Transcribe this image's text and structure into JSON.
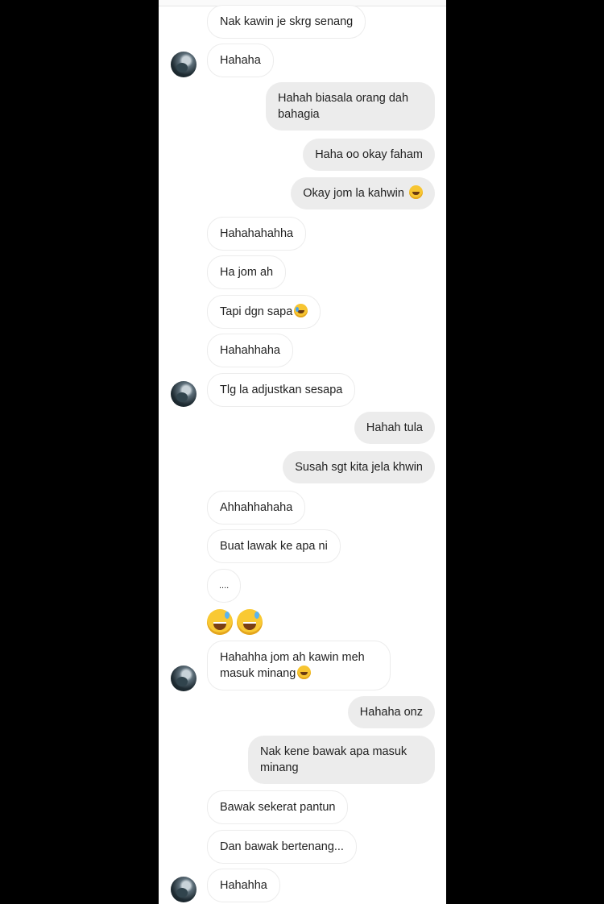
{
  "messages": [
    {
      "side": "in",
      "text": "Nak kawin je skrg senang"
    },
    {
      "side": "in",
      "text": "Hahaha"
    },
    {
      "side": "out",
      "text": "Hahah biasala orang dah bahagia"
    },
    {
      "side": "out",
      "text": "Haha oo okay faham"
    },
    {
      "side": "out",
      "text": "Okay jom la kahwin",
      "emoji": "rofl-emoji"
    },
    {
      "side": "in",
      "text": "Hahahahahha"
    },
    {
      "side": "in",
      "text": "Ha jom ah"
    },
    {
      "side": "in",
      "text": "Tapi dgn sapa",
      "emoji": "crying-emoji"
    },
    {
      "side": "in",
      "text": "Hahahhaha"
    },
    {
      "side": "in",
      "text": "Tlg la adjustkan sesapa"
    },
    {
      "side": "out",
      "text": "Hahah tula"
    },
    {
      "side": "out",
      "text": "Susah sgt kita jela khwin"
    },
    {
      "side": "in",
      "text": "Ahhahhahaha"
    },
    {
      "side": "in",
      "text": "Buat lawak ke apa ni"
    },
    {
      "side": "in",
      "text": "...."
    },
    {
      "side": "in",
      "emoji_only": [
        "sweat-smile-emoji",
        "sweat-smile-emoji"
      ]
    },
    {
      "side": "in",
      "text": "Hahahha jom ah kawin meh masuk minang",
      "emoji": "rofl-emoji"
    },
    {
      "side": "out",
      "text": "Hahaha onz"
    },
    {
      "side": "out",
      "text": "Nak kene bawak apa masuk minang"
    },
    {
      "side": "in",
      "text": "Bawak sekerat pantun"
    },
    {
      "side": "in",
      "text": "Dan bawak bertenang..."
    },
    {
      "side": "in",
      "text": "Hahahha"
    }
  ]
}
